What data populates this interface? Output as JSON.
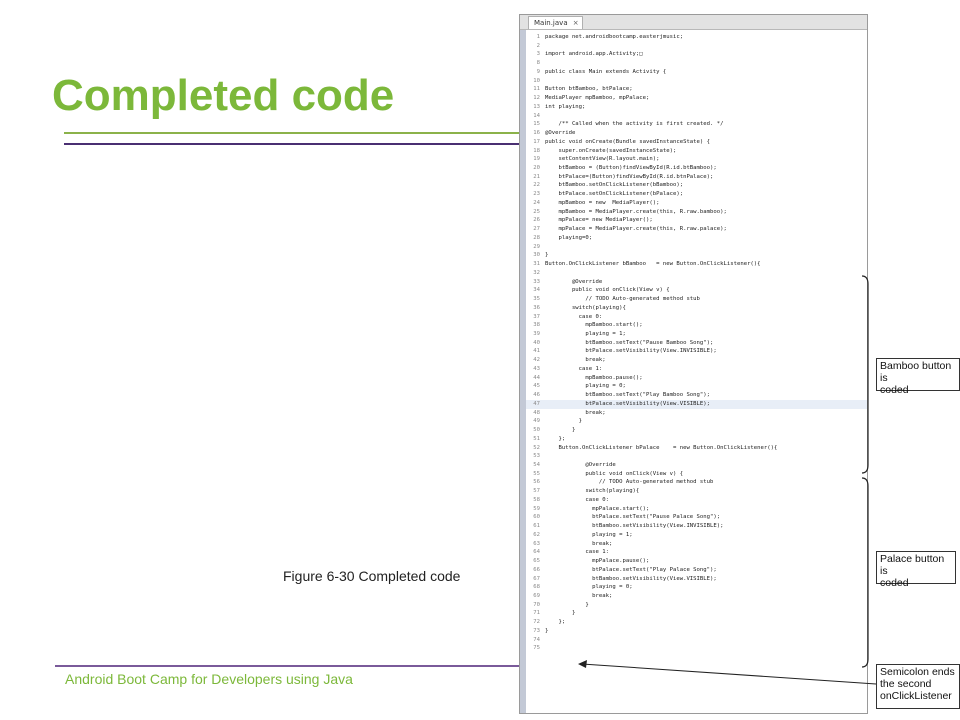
{
  "slide": {
    "title": "Completed code",
    "caption": "Figure 6-30 Completed code",
    "footer": "Android Boot Camp for Developers using Java"
  },
  "editor": {
    "tab_label": "Main.java",
    "tab_close": "×"
  },
  "code_lines": [
    {
      "n": "1",
      "t": "package net.androidbootcamp.easterjmusic;"
    },
    {
      "n": "2",
      "t": ""
    },
    {
      "n": "3",
      "t": "import android.app.Activity;□"
    },
    {
      "n": "8",
      "t": ""
    },
    {
      "n": "9",
      "t": "public class Main extends Activity {"
    },
    {
      "n": "10",
      "t": ""
    },
    {
      "n": "11",
      "t": "Button btBamboo, btPalace;"
    },
    {
      "n": "12",
      "t": "MediaPlayer mpBamboo, mpPalace;"
    },
    {
      "n": "13",
      "t": "int playing;"
    },
    {
      "n": "14",
      "t": ""
    },
    {
      "n": "15",
      "t": "    /** Called when the activity is first created. */"
    },
    {
      "n": "16",
      "t": "@Override"
    },
    {
      "n": "17",
      "t": "public void onCreate(Bundle savedInstanceState) {"
    },
    {
      "n": "18",
      "t": "    super.onCreate(savedInstanceState);"
    },
    {
      "n": "19",
      "t": "    setContentView(R.layout.main);"
    },
    {
      "n": "20",
      "t": "    btBamboo = (Button)findViewById(R.id.btBamboo);"
    },
    {
      "n": "21",
      "t": "    btPalace=(Button)findViewById(R.id.btnPalace);"
    },
    {
      "n": "22",
      "t": "    btBamboo.setOnClickListener(bBamboo);"
    },
    {
      "n": "23",
      "t": "    btPalace.setOnClickListener(bPalace);"
    },
    {
      "n": "24",
      "t": "    mpBamboo = new  MediaPlayer();"
    },
    {
      "n": "25",
      "t": "    mpBamboo = MediaPlayer.create(this, R.raw.bamboo);"
    },
    {
      "n": "26",
      "t": "    mpPalace= new MediaPlayer();"
    },
    {
      "n": "27",
      "t": "    mpPalace = MediaPlayer.create(this, R.raw.palace);"
    },
    {
      "n": "28",
      "t": "    playing=0;"
    },
    {
      "n": "29",
      "t": ""
    },
    {
      "n": "30",
      "t": "}"
    },
    {
      "n": "31",
      "t": "Button.OnClickListener bBamboo   = new Button.OnClickListener(){"
    },
    {
      "n": "32",
      "t": ""
    },
    {
      "n": "33",
      "t": "        @Override"
    },
    {
      "n": "34",
      "t": "        public void onClick(View v) {"
    },
    {
      "n": "35",
      "t": "            // TODO Auto-generated method stub"
    },
    {
      "n": "36",
      "t": "        switch(playing){"
    },
    {
      "n": "37",
      "t": "          case 0:"
    },
    {
      "n": "38",
      "t": "            mpBamboo.start();"
    },
    {
      "n": "39",
      "t": "            playing = 1;"
    },
    {
      "n": "40",
      "t": "            btBamboo.setText(\"Pause Bamboo Song\");"
    },
    {
      "n": "41",
      "t": "            btPalace.setVisibility(View.INVISIBLE);"
    },
    {
      "n": "42",
      "t": "            break;"
    },
    {
      "n": "43",
      "t": "          case 1:"
    },
    {
      "n": "44",
      "t": "            mpBamboo.pause();"
    },
    {
      "n": "45",
      "t": "            playing = 0;"
    },
    {
      "n": "46",
      "t": "            btBamboo.setText(\"Play Bamboo Song\");"
    },
    {
      "n": "47",
      "t": "            btPalace.setVisibility(View.VISIBLE);"
    },
    {
      "n": "48",
      "t": "            break;"
    },
    {
      "n": "49",
      "t": "          }"
    },
    {
      "n": "50",
      "t": "        }"
    },
    {
      "n": "51",
      "t": "    };"
    },
    {
      "n": "52",
      "t": "    Button.OnClickListener bPalace    = new Button.OnClickListener(){"
    },
    {
      "n": "53",
      "t": ""
    },
    {
      "n": "54",
      "t": "            @Override"
    },
    {
      "n": "55",
      "t": "            public void onClick(View v) {"
    },
    {
      "n": "56",
      "t": "                // TODO Auto-generated method stub"
    },
    {
      "n": "57",
      "t": "            switch(playing){"
    },
    {
      "n": "58",
      "t": "            case 0:"
    },
    {
      "n": "59",
      "t": "              mpPalace.start();"
    },
    {
      "n": "60",
      "t": "              btPalace.setText(\"Pause Palace Song\");"
    },
    {
      "n": "61",
      "t": "              btBamboo.setVisibility(View.INVISIBLE);"
    },
    {
      "n": "62",
      "t": "              playing = 1;"
    },
    {
      "n": "63",
      "t": "              break;"
    },
    {
      "n": "64",
      "t": "            case 1:"
    },
    {
      "n": "65",
      "t": "              mpPalace.pause();"
    },
    {
      "n": "66",
      "t": "              btPalace.setText(\"Play Palace Song\");"
    },
    {
      "n": "67",
      "t": "              btBamboo.setVisibility(View.VISIBLE);"
    },
    {
      "n": "68",
      "t": "              playing = 0;"
    },
    {
      "n": "69",
      "t": "              break;"
    },
    {
      "n": "70",
      "t": "            }"
    },
    {
      "n": "71",
      "t": "        }"
    },
    {
      "n": "72",
      "t": "    };"
    },
    {
      "n": "73",
      "t": "}"
    },
    {
      "n": "74",
      "t": ""
    },
    {
      "n": "75",
      "t": ""
    }
  ],
  "highlighted_line": "47",
  "callouts": {
    "bamboo": "Bamboo button is\ncoded",
    "palace": "Palace button is\ncoded",
    "semicolon": "Semicolon ends\nthe second\nonClickListener"
  }
}
